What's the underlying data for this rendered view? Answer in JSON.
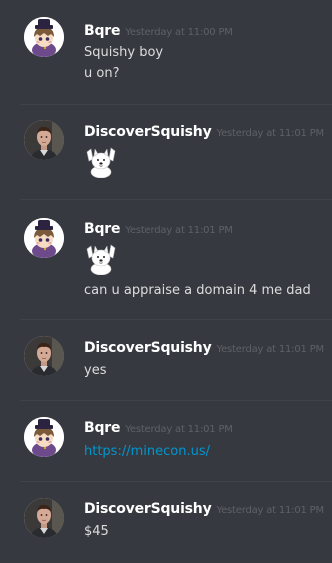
{
  "messages": [
    {
      "author": "Bqre",
      "time": "Yesterday at 11:00 PM",
      "lines": [
        "Squishy boy",
        "u on?"
      ]
    },
    {
      "author": "DiscoverSquishy",
      "time": "Yesterday at 11:01 PM",
      "emoji": "dog-waving-emoji"
    },
    {
      "author": "Bqre",
      "time": "Yesterday at 11:01 PM",
      "emoji": "dog-waving-emoji",
      "lines": [
        "can u appraise a domain 4 me dad"
      ]
    },
    {
      "author": "DiscoverSquishy",
      "time": "Yesterday at 11:01 PM",
      "lines": [
        "yes"
      ]
    },
    {
      "author": "Bqre",
      "time": "Yesterday at 11:01 PM",
      "link": "https://minecon.us/"
    },
    {
      "author": "DiscoverSquishy",
      "time": "Yesterday at 11:01 PM",
      "lines": [
        "$45"
      ]
    }
  ],
  "colors": {
    "background": "#36393f",
    "username": "#ffffff",
    "timestamp": "#5e6168",
    "message_text": "#dcddde",
    "link": "#0096cf",
    "divider": "#40434a"
  }
}
